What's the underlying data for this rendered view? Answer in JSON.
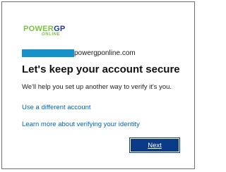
{
  "logo": {
    "power": "POWER",
    "gp": "GP",
    "online": "ONLINE",
    "power_color": "#7cc243",
    "gp_color": "#1f3a93"
  },
  "account": {
    "domain": "powergponline.com",
    "redaction_color": "#1691c8"
  },
  "page": {
    "title": "Let's keep your account secure",
    "subtitle": "We'll help you set up another way to verify it's you."
  },
  "links": {
    "different_account": "Use a different account",
    "learn_more": "Learn more about verifying your identity"
  },
  "actions": {
    "next_label": "Next",
    "button_color": "#0b3a86"
  }
}
